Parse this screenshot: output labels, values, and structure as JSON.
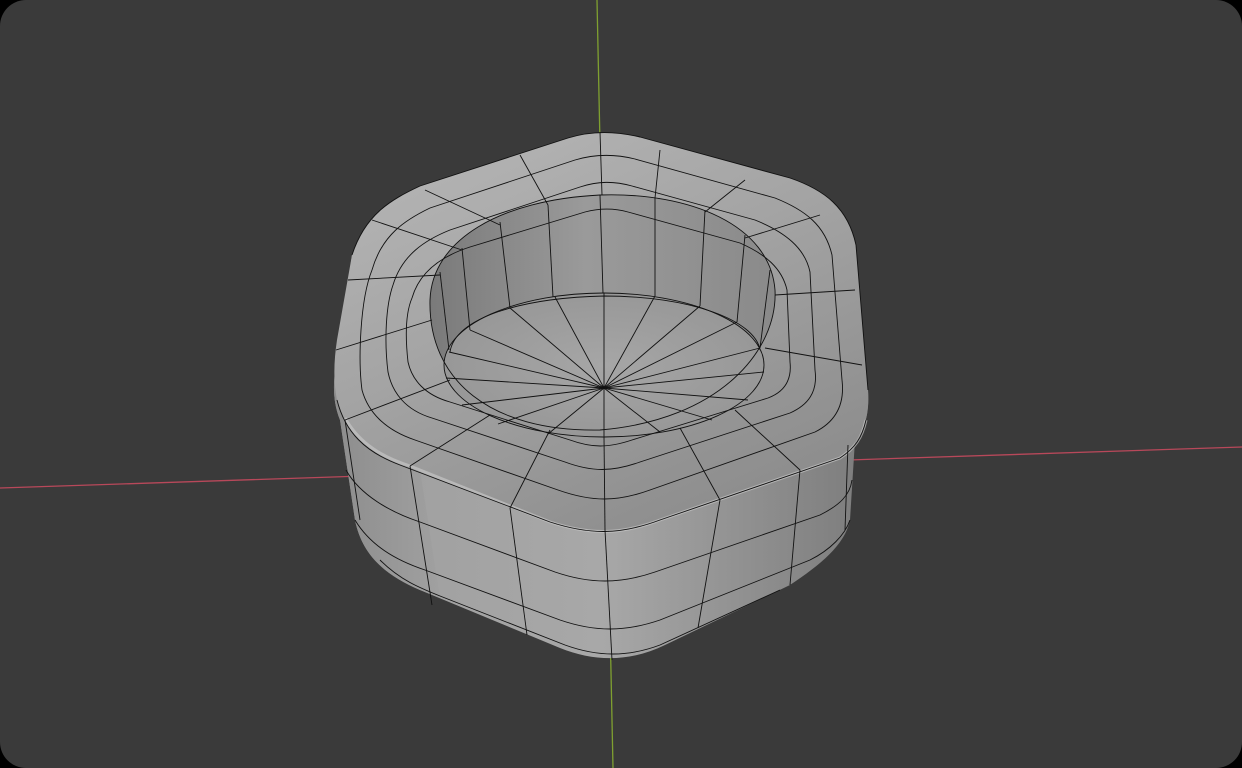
{
  "viewport": {
    "background": "#3a3a3a",
    "frame_color": "#000000",
    "x_axis_color": "#b8485a",
    "y_axis_color": "#7fa030"
  },
  "object": {
    "type": "hex-nut-mesh",
    "shading": "solid",
    "wireframe_overlay": true,
    "base_color": "#9a9a9a",
    "wire_color": "#111111"
  }
}
